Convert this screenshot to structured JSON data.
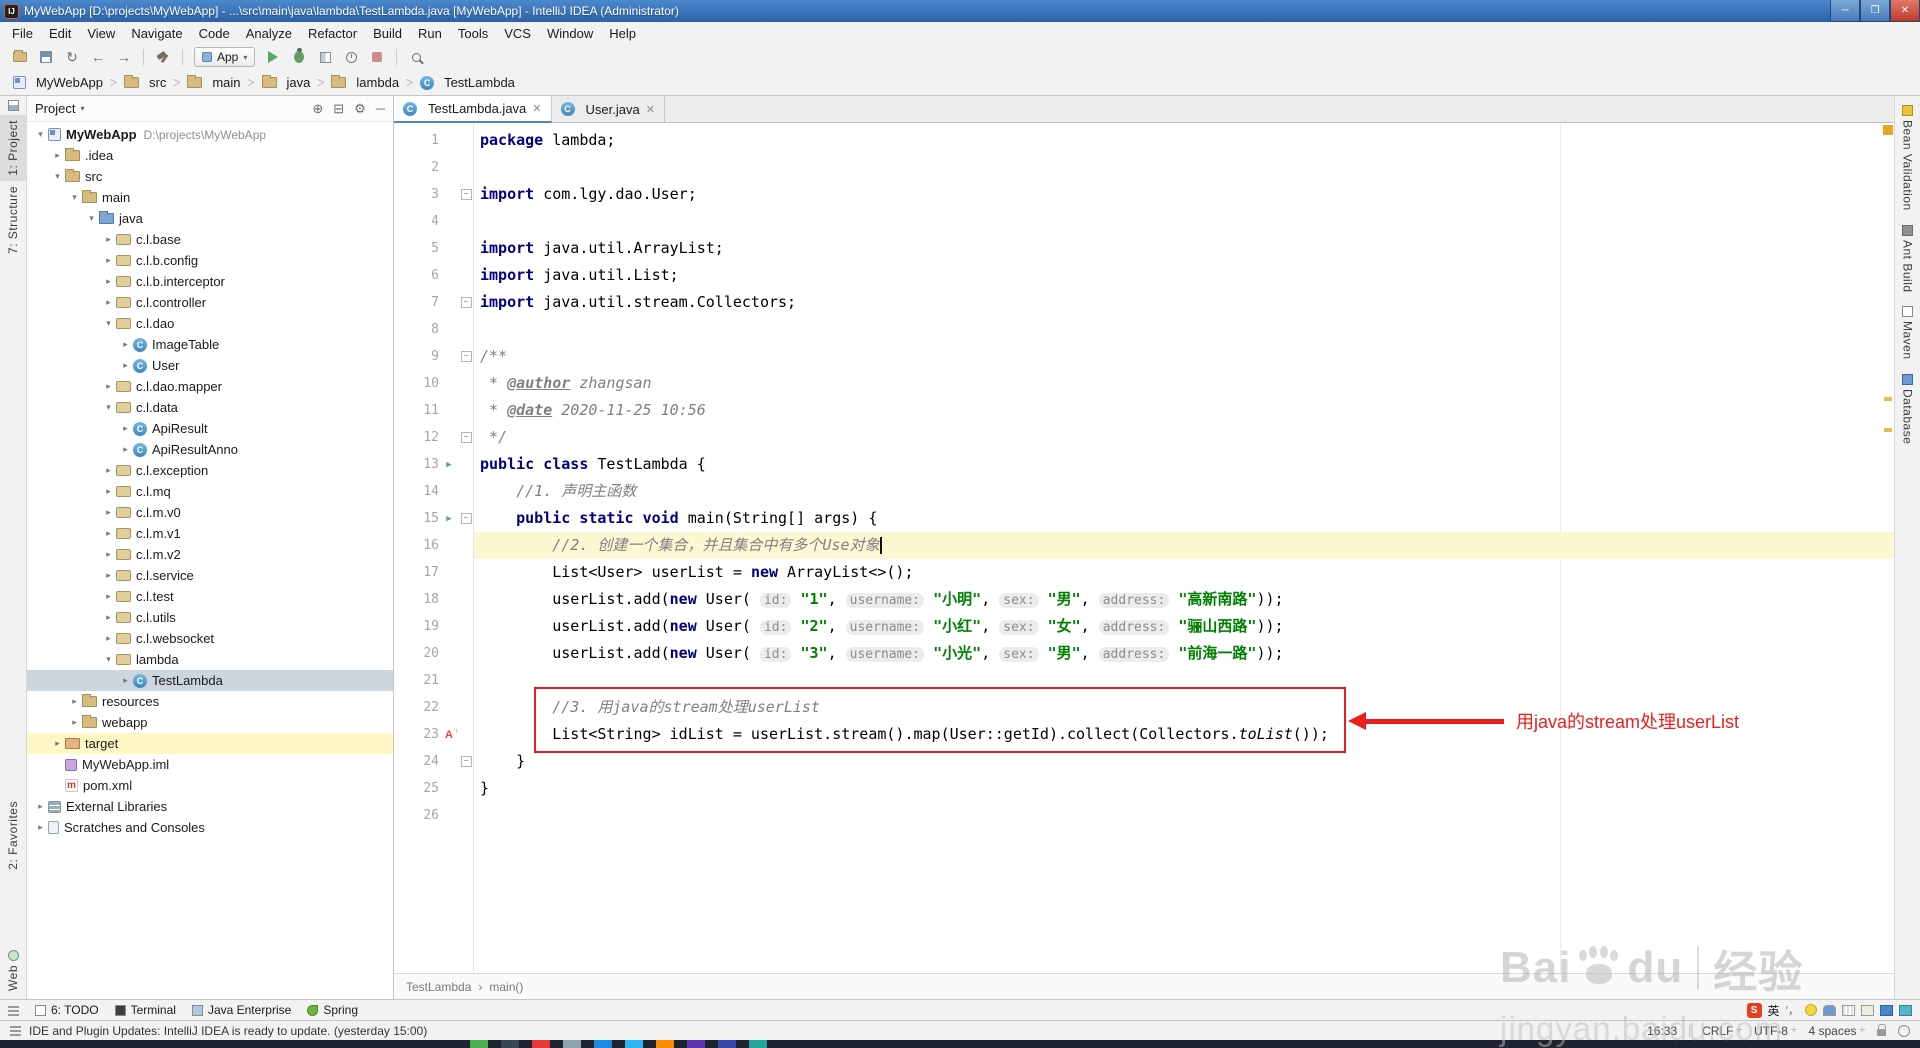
{
  "window": {
    "title": "MyWebApp [D:\\projects\\MyWebApp] - ...\\src\\main\\java\\lambda\\TestLambda.java [MyWebApp] - IntelliJ IDEA (Administrator)",
    "app_initials": "IJ",
    "buttons": {
      "minimize": "─",
      "maximize": "❐",
      "close": "✕"
    }
  },
  "menu": {
    "items": [
      "File",
      "Edit",
      "View",
      "Navigate",
      "Code",
      "Analyze",
      "Refactor",
      "Build",
      "Run",
      "Tools",
      "VCS",
      "Window",
      "Help"
    ]
  },
  "toolbar": {
    "run_config": "App",
    "icons": [
      {
        "name": "open-file"
      },
      {
        "name": "save-all"
      },
      {
        "name": "synchronize",
        "glyph": "↻"
      },
      {
        "name": "back",
        "glyph": "←"
      },
      {
        "name": "forward",
        "glyph": "→"
      },
      {
        "sep": true
      },
      {
        "name": "build-project"
      },
      {
        "sep": true
      },
      {
        "combo": true
      },
      {
        "name": "run"
      },
      {
        "name": "debug"
      },
      {
        "name": "coverage"
      },
      {
        "name": "profiler"
      },
      {
        "name": "stop"
      },
      {
        "sep": true
      },
      {
        "name": "search-everywhere"
      }
    ]
  },
  "breadcrumbs": [
    {
      "label": "MyWebApp",
      "icon": "module"
    },
    {
      "label": "src",
      "icon": "folder"
    },
    {
      "label": "main",
      "icon": "folder"
    },
    {
      "label": "java",
      "icon": "folder"
    },
    {
      "label": "lambda",
      "icon": "folder"
    },
    {
      "label": "TestLambda",
      "icon": "class"
    }
  ],
  "project_panel": {
    "title": "Project",
    "tree": [
      {
        "label": "MyWebApp",
        "suffix": "D:\\projects\\MyWebApp",
        "depth": 0,
        "icon": "module",
        "arrow": "open",
        "bold": true
      },
      {
        "label": ".idea",
        "depth": 1,
        "icon": "folder",
        "arrow": "closed"
      },
      {
        "label": "src",
        "depth": 1,
        "icon": "folder",
        "arrow": "open"
      },
      {
        "label": "main",
        "depth": 2,
        "icon": "folder",
        "arrow": "open"
      },
      {
        "label": "java",
        "depth": 3,
        "icon": "srcfolder",
        "arrow": "open"
      },
      {
        "label": "c.l.base",
        "depth": 4,
        "icon": "package",
        "arrow": "closed"
      },
      {
        "label": "c.l.b.config",
        "depth": 4,
        "icon": "package",
        "arrow": "closed"
      },
      {
        "label": "c.l.b.interceptor",
        "depth": 4,
        "icon": "package",
        "arrow": "closed"
      },
      {
        "label": "c.l.controller",
        "depth": 4,
        "icon": "package",
        "arrow": "closed"
      },
      {
        "label": "c.l.dao",
        "depth": 4,
        "icon": "package",
        "arrow": "open"
      },
      {
        "label": "ImageTable",
        "depth": 5,
        "icon": "class",
        "arrow": "closed"
      },
      {
        "label": "User",
        "depth": 5,
        "icon": "class",
        "arrow": "closed"
      },
      {
        "label": "c.l.dao.mapper",
        "depth": 4,
        "icon": "package",
        "arrow": "closed"
      },
      {
        "label": "c.l.data",
        "depth": 4,
        "icon": "package",
        "arrow": "open"
      },
      {
        "label": "ApiResult",
        "depth": 5,
        "icon": "class",
        "arrow": "closed"
      },
      {
        "label": "ApiResultAnno",
        "depth": 5,
        "icon": "class",
        "arrow": "closed"
      },
      {
        "label": "c.l.exception",
        "depth": 4,
        "icon": "package",
        "arrow": "closed"
      },
      {
        "label": "c.l.mq",
        "depth": 4,
        "icon": "package",
        "arrow": "closed"
      },
      {
        "label": "c.l.m.v0",
        "depth": 4,
        "icon": "package",
        "arrow": "closed"
      },
      {
        "label": "c.l.m.v1",
        "depth": 4,
        "icon": "package",
        "arrow": "closed"
      },
      {
        "label": "c.l.m.v2",
        "depth": 4,
        "icon": "package",
        "arrow": "closed"
      },
      {
        "label": "c.l.service",
        "depth": 4,
        "icon": "package",
        "arrow": "closed"
      },
      {
        "label": "c.l.test",
        "depth": 4,
        "icon": "package",
        "arrow": "closed"
      },
      {
        "label": "c.l.utils",
        "depth": 4,
        "icon": "package",
        "arrow": "closed"
      },
      {
        "label": "c.l.websocket",
        "depth": 4,
        "icon": "package",
        "arrow": "closed"
      },
      {
        "label": "lambda",
        "depth": 4,
        "icon": "package",
        "arrow": "open"
      },
      {
        "label": "TestLambda",
        "depth": 5,
        "icon": "class",
        "arrow": "closed",
        "selected": true
      },
      {
        "label": "resources",
        "depth": 2,
        "icon": "folder",
        "arrow": "closed"
      },
      {
        "label": "webapp",
        "depth": 2,
        "icon": "folder",
        "arrow": "closed"
      },
      {
        "label": "target",
        "depth": 1,
        "icon": "folder-excluded",
        "arrow": "closed",
        "highlight": true
      },
      {
        "label": "MyWebApp.iml",
        "depth": 1,
        "icon": "iml",
        "arrow": "none"
      },
      {
        "label": "pom.xml",
        "depth": 1,
        "icon": "maven",
        "arrow": "none"
      },
      {
        "label": "External Libraries",
        "depth": 0,
        "icon": "libs",
        "arrow": "closed"
      },
      {
        "label": "Scratches and Consoles",
        "depth": 0,
        "icon": "scratch",
        "arrow": "closed"
      }
    ]
  },
  "editor": {
    "tabs": [
      {
        "label": "TestLambda.java",
        "active": true
      },
      {
        "label": "User.java",
        "active": false
      }
    ],
    "lines": [
      {
        "n": 1,
        "seg": [
          [
            "kw",
            "package"
          ],
          [
            "pl",
            " lambda;"
          ]
        ]
      },
      {
        "n": 2,
        "seg": []
      },
      {
        "n": 3,
        "fold": true,
        "seg": [
          [
            "kw",
            "import"
          ],
          [
            "pl",
            " com.lgy.dao.User;"
          ]
        ]
      },
      {
        "n": 4,
        "seg": []
      },
      {
        "n": 5,
        "seg": [
          [
            "kw",
            "import"
          ],
          [
            "pl",
            " java.util.ArrayList;"
          ]
        ]
      },
      {
        "n": 6,
        "seg": [
          [
            "kw",
            "import"
          ],
          [
            "pl",
            " java.util.List;"
          ]
        ]
      },
      {
        "n": 7,
        "fold": true,
        "seg": [
          [
            "kw",
            "import"
          ],
          [
            "pl",
            " java.util.stream.Collectors;"
          ]
        ]
      },
      {
        "n": 8,
        "seg": []
      },
      {
        "n": 9,
        "fold": true,
        "seg": [
          [
            "doc",
            "/**"
          ]
        ]
      },
      {
        "n": 10,
        "seg": [
          [
            "doc",
            " * "
          ],
          [
            "tag",
            "@author"
          ],
          [
            "doc",
            " zhangsan"
          ]
        ]
      },
      {
        "n": 11,
        "seg": [
          [
            "doc",
            " * "
          ],
          [
            "tag",
            "@date"
          ],
          [
            "doc",
            " 2020-11-25 10:56"
          ]
        ]
      },
      {
        "n": 12,
        "fold": true,
        "seg": [
          [
            "doc",
            " */"
          ]
        ]
      },
      {
        "n": 13,
        "gutter": "run",
        "seg": [
          [
            "kw",
            "public"
          ],
          [
            "pl",
            " "
          ],
          [
            "kw",
            "class"
          ],
          [
            "pl",
            " TestLambda {"
          ]
        ]
      },
      {
        "n": 14,
        "seg": [
          [
            "pl",
            "    "
          ],
          [
            "cmt",
            "//1. 声明主函数"
          ]
        ]
      },
      {
        "n": 15,
        "gutter": "run",
        "fold": true,
        "seg": [
          [
            "pl",
            "    "
          ],
          [
            "kw",
            "public"
          ],
          [
            "pl",
            " "
          ],
          [
            "kw",
            "static"
          ],
          [
            "pl",
            " "
          ],
          [
            "kw",
            "void"
          ],
          [
            "pl",
            " main(String[] args) {"
          ]
        ]
      },
      {
        "n": 16,
        "current": true,
        "caret": true,
        "seg": [
          [
            "pl",
            "        "
          ],
          [
            "cmt",
            "//2. 创建一个集合，并且集合中有多个Use对象"
          ]
        ]
      },
      {
        "n": 17,
        "seg": [
          [
            "pl",
            "        List<User> userList = "
          ],
          [
            "kw",
            "new"
          ],
          [
            "pl",
            " ArrayList<>();"
          ]
        ]
      },
      {
        "n": 18,
        "seg": [
          [
            "pl",
            "        userList.add("
          ],
          [
            "kw",
            "new"
          ],
          [
            "pl",
            " User( "
          ],
          [
            "hint",
            "id:"
          ],
          [
            "pl",
            " "
          ],
          [
            "str",
            "\"1\""
          ],
          [
            "pl",
            ", "
          ],
          [
            "hint",
            "username:"
          ],
          [
            "pl",
            " "
          ],
          [
            "str",
            "\"小明\""
          ],
          [
            "pl",
            ", "
          ],
          [
            "hint",
            "sex:"
          ],
          [
            "pl",
            " "
          ],
          [
            "str",
            "\"男\""
          ],
          [
            "pl",
            ", "
          ],
          [
            "hint",
            "address:"
          ],
          [
            "pl",
            " "
          ],
          [
            "str",
            "\"高新南路\""
          ],
          [
            "pl",
            "));"
          ]
        ]
      },
      {
        "n": 19,
        "seg": [
          [
            "pl",
            "        userList.add("
          ],
          [
            "kw",
            "new"
          ],
          [
            "pl",
            " User( "
          ],
          [
            "hint",
            "id:"
          ],
          [
            "pl",
            " "
          ],
          [
            "str",
            "\"2\""
          ],
          [
            "pl",
            ", "
          ],
          [
            "hint",
            "username:"
          ],
          [
            "pl",
            " "
          ],
          [
            "str",
            "\"小红\""
          ],
          [
            "pl",
            ", "
          ],
          [
            "hint",
            "sex:"
          ],
          [
            "pl",
            " "
          ],
          [
            "str",
            "\"女\""
          ],
          [
            "pl",
            ", "
          ],
          [
            "hint",
            "address:"
          ],
          [
            "pl",
            " "
          ],
          [
            "str",
            "\"骊山西路\""
          ],
          [
            "pl",
            "));"
          ]
        ]
      },
      {
        "n": 20,
        "seg": [
          [
            "pl",
            "        userList.add("
          ],
          [
            "kw",
            "new"
          ],
          [
            "pl",
            " User( "
          ],
          [
            "hint",
            "id:"
          ],
          [
            "pl",
            " "
          ],
          [
            "str",
            "\"3\""
          ],
          [
            "pl",
            ", "
          ],
          [
            "hint",
            "username:"
          ],
          [
            "pl",
            " "
          ],
          [
            "str",
            "\"小光\""
          ],
          [
            "pl",
            ", "
          ],
          [
            "hint",
            "sex:"
          ],
          [
            "pl",
            " "
          ],
          [
            "str",
            "\"男\""
          ],
          [
            "pl",
            ", "
          ],
          [
            "hint",
            "address:"
          ],
          [
            "pl",
            " "
          ],
          [
            "str",
            "\"前海一路\""
          ],
          [
            "pl",
            "));"
          ]
        ]
      },
      {
        "n": 21,
        "seg": []
      },
      {
        "n": 22,
        "seg": [
          [
            "pl",
            "        "
          ],
          [
            "cmt",
            "//3. 用java的stream处理userList"
          ]
        ]
      },
      {
        "n": 23,
        "gutter": "marker",
        "seg": [
          [
            "pl",
            "        List<String> idList = userList.stream().map(User::getId).collect(Collectors."
          ],
          [
            "itl",
            "toList"
          ],
          [
            "pl",
            "());"
          ]
        ]
      },
      {
        "n": 24,
        "fold": true,
        "seg": [
          [
            "pl",
            "    }"
          ]
        ]
      },
      {
        "n": 25,
        "seg": [
          [
            "pl",
            "}"
          ]
        ]
      },
      {
        "n": 26,
        "seg": []
      }
    ],
    "breadcrumb": [
      "TestLambda",
      "main()"
    ],
    "annotation": {
      "label": "用java的stream处理userList"
    }
  },
  "tool_windows": {
    "left_top": [
      {
        "label": "1: Project",
        "active": true
      },
      {
        "label": "7: Structure",
        "active": false
      }
    ],
    "left_bottom": [
      {
        "label": "2: Favorites"
      },
      {
        "label": "Web"
      }
    ],
    "right": [
      {
        "label": "Bean Validation",
        "icon": "bean"
      },
      {
        "label": "Ant Build",
        "icon": "ant"
      },
      {
        "label": "Maven",
        "icon": "maven"
      },
      {
        "label": "Database",
        "icon": "database"
      }
    ],
    "bottom": [
      {
        "label": "6: TODO",
        "icon": "todo"
      },
      {
        "label": "Terminal",
        "icon": "terminal"
      },
      {
        "label": "Java Enterprise",
        "icon": "javaee"
      },
      {
        "label": "Spring",
        "icon": "spring"
      }
    ]
  },
  "ime": {
    "logo": "S",
    "lang": "英",
    "punct": "’，"
  },
  "status_bar": {
    "message": "IDE and Plugin Updates: IntelliJ IDEA is ready to update. (yesterday 15:00)",
    "time": "16:33",
    "widgets": [
      "CRLF",
      "UTF-8",
      "4 spaces"
    ]
  },
  "taskbar": {
    "items": [
      {
        "name": "app-1",
        "color": "#4caf50"
      },
      {
        "name": "app-2",
        "color": "#37474f"
      },
      {
        "name": "app-3",
        "color": "#e53935"
      },
      {
        "name": "app-4",
        "color": "#90a4ae"
      },
      {
        "name": "app-5",
        "color": "#1e88e5"
      },
      {
        "name": "app-6",
        "color": "#29b6f6"
      },
      {
        "name": "app-7",
        "color": "#fb8c00"
      },
      {
        "name": "app-8",
        "color": "#5e35b1"
      },
      {
        "name": "app-9",
        "color": "#3949ab"
      },
      {
        "name": "app-10",
        "color": "#26a69a"
      }
    ]
  },
  "watermark": {
    "text_left": "Bai",
    "text_right": "du",
    "suffix": "经验",
    "url": "jingyan.baidu.com"
  }
}
